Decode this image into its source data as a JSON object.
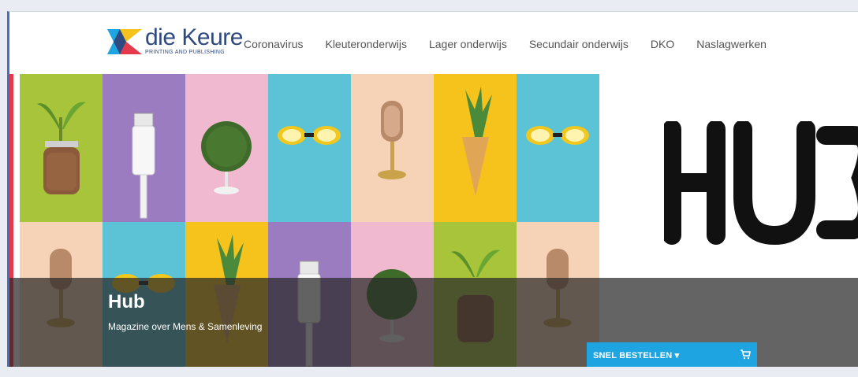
{
  "brand": {
    "name": "die Keure",
    "tagline": "PRINTING AND PUBLISHING",
    "colors": {
      "blue": "#2f4a80",
      "yellow": "#f6c21c",
      "red": "#e53a4c",
      "cyan": "#1ea4e0"
    }
  },
  "nav": {
    "items": [
      {
        "label": "Coronavirus"
      },
      {
        "label": "Kleuteronderwijs"
      },
      {
        "label": "Lager onderwijs"
      },
      {
        "label": "Secundair onderwijs"
      },
      {
        "label": "DKO"
      },
      {
        "label": "Naslagwerken"
      }
    ]
  },
  "hero": {
    "title": "Hub",
    "subtitle": "Magazine over Mens & Samenleving",
    "logo_text": "HUB",
    "tile_colors": [
      "#a8c43a",
      "#9b7cc0",
      "#f1b9d0",
      "#5bc3d5",
      "#f6d3b6",
      "#f6c21c",
      "#5bc3d5",
      "#f6d3b6",
      "#5bc3d5",
      "#f6c21c",
      "#9b7cc0",
      "#f1b9d0",
      "#a8c43a",
      "#f6d3b6"
    ],
    "tile_icons": [
      "plant-jar-icon",
      "usb-cable-icon",
      "bush-globe-icon",
      "goggles-icon",
      "microphone-icon",
      "pineapple-cone-icon",
      "goggles-icon",
      "microphone-icon",
      "goggles-icon",
      "pineapple-cone-icon",
      "usb-cable-icon",
      "bush-globe-icon",
      "plant-jar-icon",
      "microphone-icon"
    ]
  },
  "order": {
    "label": "SNEL BESTELLEN ▾",
    "icon": "cart-icon"
  }
}
